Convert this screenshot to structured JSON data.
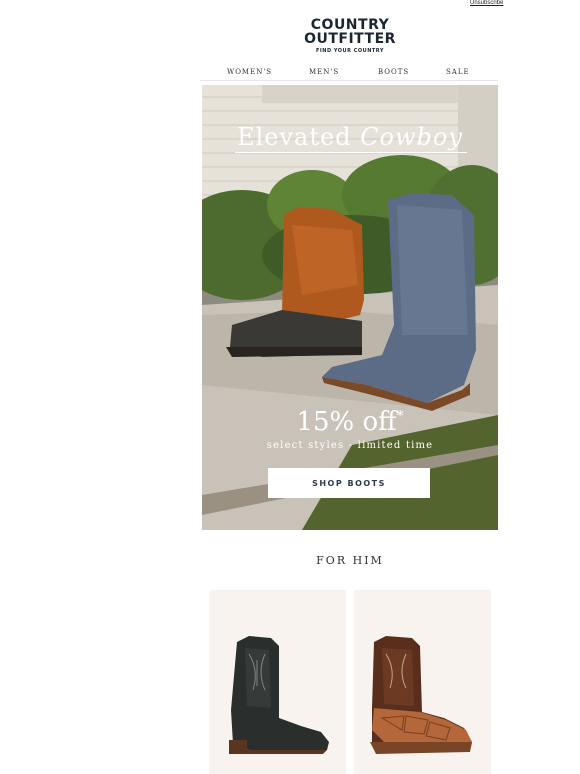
{
  "top": {
    "unsubscribe": "Unsubscribe"
  },
  "logo": {
    "line1": "COUNTRY",
    "line2": "OUTFITTER",
    "tagline": "FIND YOUR COUNTRY"
  },
  "nav": [
    "WOMEN'S",
    "MEN'S",
    "BOOTS",
    "SALE"
  ],
  "hero": {
    "title_plain": "Elevated",
    "title_italic": "Cowboy",
    "offer": "15% off",
    "offer_mark": "*",
    "subline": "select styles - limited time",
    "cta": "SHOP BOOTS"
  },
  "section": {
    "title": "FOR HIM"
  },
  "products": [
    {
      "icon": "black-caiman-boot-icon",
      "color": "#2a2e2d"
    },
    {
      "icon": "brown-pirarucu-boot-icon",
      "color": "#8a4a2a"
    }
  ],
  "colors": {
    "nav_text": "#333333",
    "button_text": "#2c3a4a",
    "card_bg": "#f8f3ee"
  }
}
